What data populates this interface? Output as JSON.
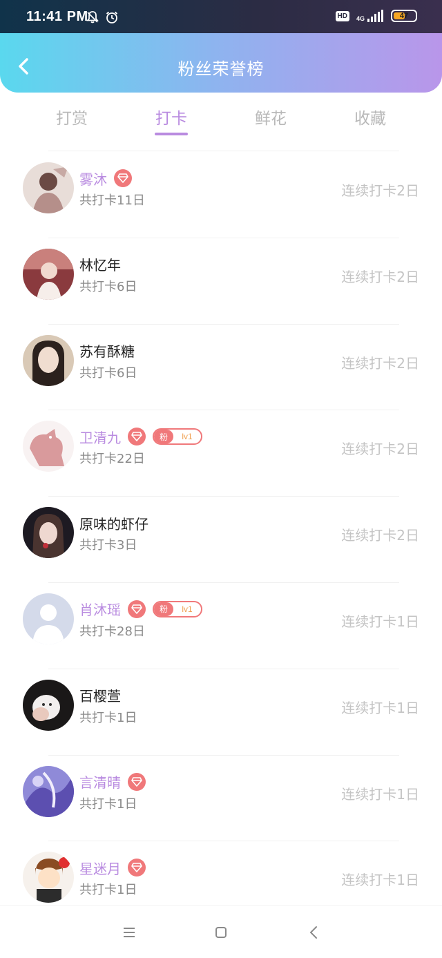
{
  "status_bar": {
    "time": "11:41 PM",
    "hd": "HD",
    "network": "4G",
    "battery": "47",
    "icons": [
      "bell-off-icon",
      "alarm-icon",
      "signal-icon",
      "battery-icon"
    ]
  },
  "header": {
    "title": "粉丝荣誉榜",
    "gradient": [
      "#5ad8ee",
      "#b996ea"
    ]
  },
  "tabs": [
    {
      "label": "打赏",
      "active": false
    },
    {
      "label": "打卡",
      "active": true
    },
    {
      "label": "鲜花",
      "active": false
    },
    {
      "label": "收藏",
      "active": false
    }
  ],
  "colors": {
    "accent": "#b98be0",
    "badge": "#f0787a",
    "muted": "#c4c4c4"
  },
  "fans": [
    {
      "name": "雾沐",
      "vip": true,
      "fan_badge": false,
      "total": "共打卡11日",
      "streak": "连续打卡2日"
    },
    {
      "name": "林忆年",
      "vip": false,
      "fan_badge": false,
      "total": "共打卡6日",
      "streak": "连续打卡2日"
    },
    {
      "name": "苏有酥糖",
      "vip": false,
      "fan_badge": false,
      "total": "共打卡6日",
      "streak": "连续打卡2日"
    },
    {
      "name": "卫清九",
      "vip": true,
      "fan_badge": true,
      "badge_label": "粉",
      "badge_level": "lv1",
      "total": "共打卡22日",
      "streak": "连续打卡2日"
    },
    {
      "name": "原味的虾仔",
      "vip": false,
      "fan_badge": false,
      "total": "共打卡3日",
      "streak": "连续打卡2日"
    },
    {
      "name": "肖沐瑶",
      "vip": true,
      "fan_badge": true,
      "badge_label": "粉",
      "badge_level": "lv1",
      "total": "共打卡28日",
      "streak": "连续打卡1日"
    },
    {
      "name": "百樱萱",
      "vip": false,
      "fan_badge": false,
      "total": "共打卡1日",
      "streak": "连续打卡1日"
    },
    {
      "name": "言清晴",
      "vip": true,
      "fan_badge": false,
      "total": "共打卡1日",
      "streak": "连续打卡1日"
    },
    {
      "name": "星迷月",
      "vip": true,
      "fan_badge": false,
      "total": "共打卡1日",
      "streak": "连续打卡1日"
    }
  ],
  "nav": [
    "menu-icon",
    "home-icon",
    "back-icon"
  ]
}
